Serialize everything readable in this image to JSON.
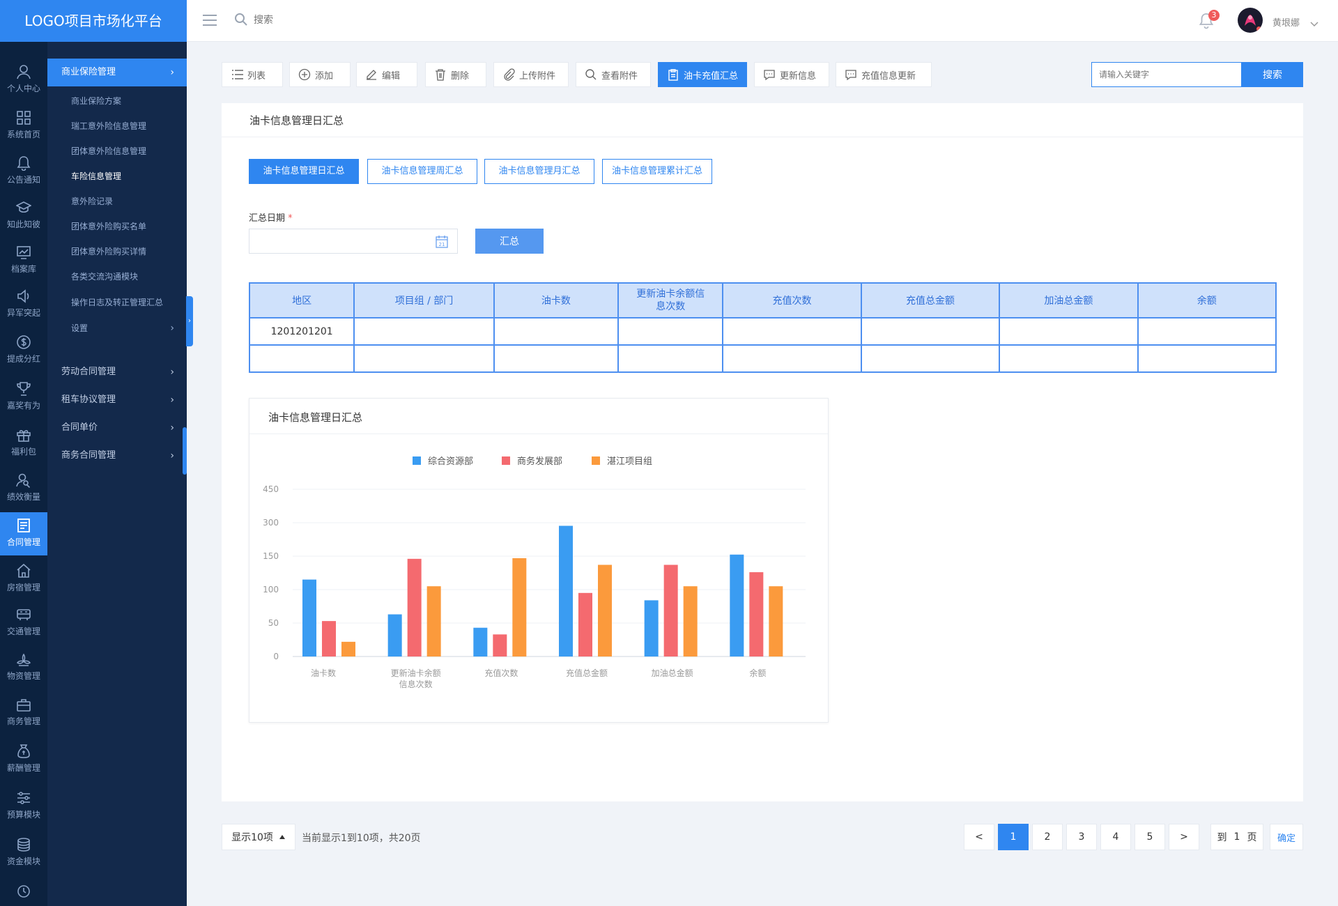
{
  "logo": {
    "text": "LOGO项目市场化平台"
  },
  "header": {
    "search_placeholder": "搜索",
    "notif_count": "3",
    "user_name": "黄垠娜"
  },
  "rail": [
    {
      "label": "个人中心",
      "icon": "user-icon"
    },
    {
      "label": "系统首页",
      "icon": "grid-icon"
    },
    {
      "label": "公告通知",
      "icon": "bell-icon"
    },
    {
      "label": "知此知彼",
      "icon": "graduation-cap-icon"
    },
    {
      "label": "档案库",
      "icon": "monitor-chart-icon"
    },
    {
      "label": "异军突起",
      "icon": "speaker-icon"
    },
    {
      "label": "提成分红",
      "icon": "dollar-icon"
    },
    {
      "label": "嘉奖有为",
      "icon": "trophy-icon"
    },
    {
      "label": "福利包",
      "icon": "gift-icon"
    },
    {
      "label": "绩效衡量",
      "icon": "user-search-icon"
    },
    {
      "label": "合同管理",
      "icon": "contract-icon"
    },
    {
      "label": "房宿管理",
      "icon": "house-icon"
    },
    {
      "label": "交通管理",
      "icon": "bus-icon"
    },
    {
      "label": "物资管理",
      "icon": "lotus-icon"
    },
    {
      "label": "商务管理",
      "icon": "briefcase-icon"
    },
    {
      "label": "薪酬管理",
      "icon": "money-bag-icon"
    },
    {
      "label": "预算模块",
      "icon": "sliders-icon"
    },
    {
      "label": "资金模块",
      "icon": "coins-icon"
    }
  ],
  "submenu": {
    "group1": "商业保险管理",
    "items": [
      "商业保险方案",
      "瑞工意外险信息管理",
      "团体意外险信息管理",
      "车险信息管理",
      "意外险记录",
      "团体意外险购买名单",
      "团体意外险购买详情",
      "各类交流沟通模块",
      "操作日志及转正管理汇总",
      "设置"
    ],
    "groups": [
      "劳动合同管理",
      "租车协议管理",
      "合同单价",
      "商务合同管理"
    ]
  },
  "toolbar": [
    "列表",
    "添加",
    "编辑",
    "删除",
    "上传附件",
    "查看附件",
    "油卡充值汇总",
    "更新信息",
    "充值信息更新"
  ],
  "search": {
    "placeholder": "请输入关键字",
    "button": "搜索"
  },
  "card": {
    "title": "油卡信息管理日汇总"
  },
  "subtabs": [
    "油卡信息管理日汇总",
    "油卡信息管理周汇总",
    "油卡信息管理月汇总",
    "油卡信息管理累计汇总"
  ],
  "form": {
    "date_label": "汇总日期",
    "required": "*",
    "submit": "汇总"
  },
  "table": {
    "headers": [
      "地区",
      "项目组 / 部门",
      "油卡数",
      "更新油卡余额信息次数",
      "充值次数",
      "充值总金额",
      "加油总金额",
      "余额"
    ],
    "rows": [
      [
        "1201201201",
        "",
        "",
        "",
        "",
        "",
        "",
        ""
      ],
      [
        "",
        "",
        "",
        "",
        "",
        "",
        "",
        ""
      ]
    ]
  },
  "chart_panel": {
    "title": "油卡信息管理日汇总"
  },
  "chart_data": {
    "type": "bar",
    "categories": [
      "油卡数",
      "更新油卡余额信息次数",
      "充值次数",
      "充值总金额",
      "加油总金额",
      "余额"
    ],
    "series": [
      {
        "name": "综合资源部",
        "values": [
          115,
          63,
          43,
          286,
          84,
          157
        ],
        "color": "#3a9cf2"
      },
      {
        "name": "商务发展部",
        "values": [
          53,
          146,
          33,
          95,
          137,
          126
        ],
        "color": "#f46a6f"
      },
      {
        "name": "湛江项目组",
        "values": [
          22,
          105,
          147,
          137,
          105,
          105
        ],
        "color": "#fb9a3c"
      }
    ],
    "yticks": [
      0,
      50,
      100,
      150,
      300,
      450
    ]
  },
  "pagination": {
    "page_size": "显示10项",
    "info": "当前显示1到10项，共20页",
    "pages": [
      "1",
      "2",
      "3",
      "4",
      "5"
    ],
    "prev": "<",
    "next": ">",
    "goto_prefix": "到",
    "goto_value": "1",
    "goto_suffix": "页",
    "confirm": "确定"
  }
}
